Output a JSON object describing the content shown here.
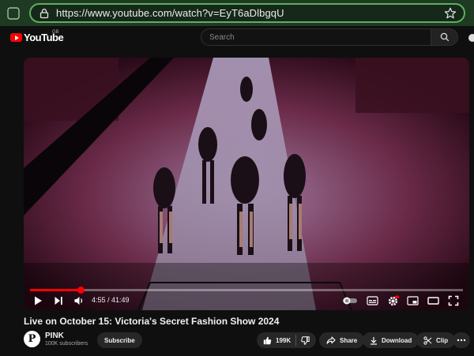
{
  "browser": {
    "url": "https://www.youtube.com/watch?v=EyT6aDlbgqU"
  },
  "header": {
    "logo_text": "YouTube",
    "region": "GB",
    "search_placeholder": "Search"
  },
  "player": {
    "current_time": "4:55",
    "duration": "41:49",
    "time_display": "4:55 / 41:49",
    "progress_fraction": 0.118,
    "accent_color": "#ff0000"
  },
  "video": {
    "title": "Live on October 15: Victoria's Secret Fashion Show 2024"
  },
  "channel": {
    "name": "PINK",
    "subscribers": "100K subscribers",
    "avatar_letter": "P",
    "subscribe_label": "Subscribe"
  },
  "actions": {
    "like_count": "199K",
    "share_label": "Share",
    "download_label": "Download",
    "clip_label": "Clip"
  }
}
